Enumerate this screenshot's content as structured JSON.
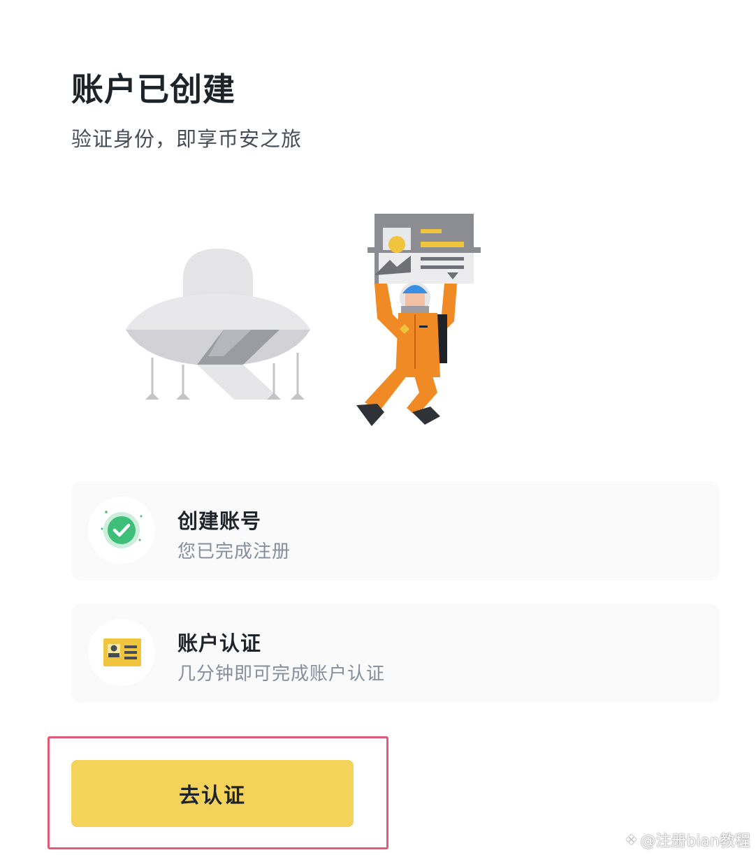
{
  "header": {
    "title": "账户已创建",
    "subtitle": "验证身份，即享币安之旅"
  },
  "steps": [
    {
      "title": "创建账号",
      "description": "您已完成注册",
      "icon": "check-circle-icon",
      "status": "completed",
      "accent": "#3dbf7a"
    },
    {
      "title": "账户认证",
      "description": "几分钟即可完成账户认证",
      "icon": "id-card-icon",
      "status": "pending",
      "accent": "#f0c43c"
    }
  ],
  "cta": {
    "label": "去认证",
    "color": "#f3d35a"
  },
  "watermark": {
    "text": "@注册bian教程"
  },
  "colors": {
    "highlight_border": "#e05a7a",
    "astronaut_suit": "#f08a24",
    "helmet": "#3a8ee6"
  }
}
